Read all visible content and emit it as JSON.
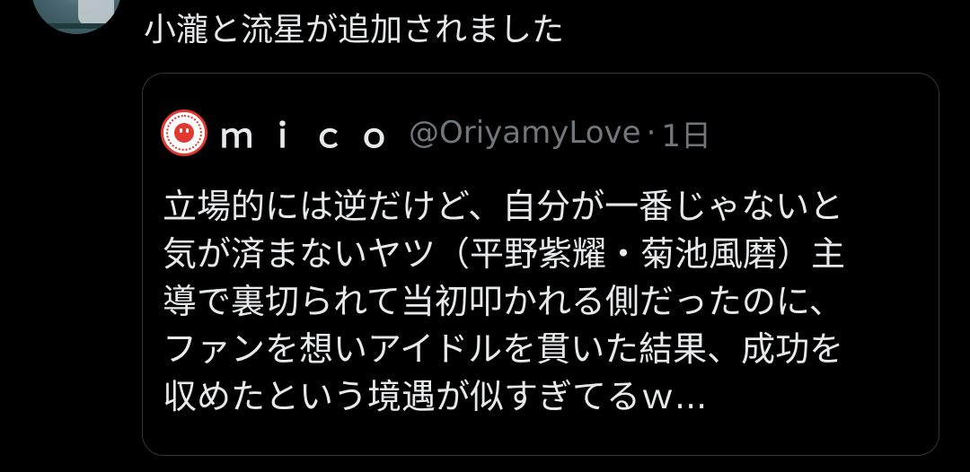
{
  "tweet": {
    "text": "小瀧と流星が追加されました"
  },
  "quote": {
    "author": {
      "display_name": "ｍｉｃｏ",
      "handle": "@OriyamyLove",
      "separator": "·",
      "time": "1日"
    },
    "lines": [
      "立場的には逆だけど、自分が一番じゃないと",
      "気が済まないヤツ（平野紫耀・菊池風磨）主",
      "導で裏切られて当初叩かれる側だったのに、",
      "ファンを想いアイドルを貫いた結果、成功を",
      "収めたという境遇が似すぎてるｗ..."
    ]
  },
  "colors": {
    "background": "#000000",
    "text_primary": "#e7e9ea",
    "text_secondary": "#71767b",
    "card_border": "#333639",
    "avatar_accent": "#e0392f"
  }
}
